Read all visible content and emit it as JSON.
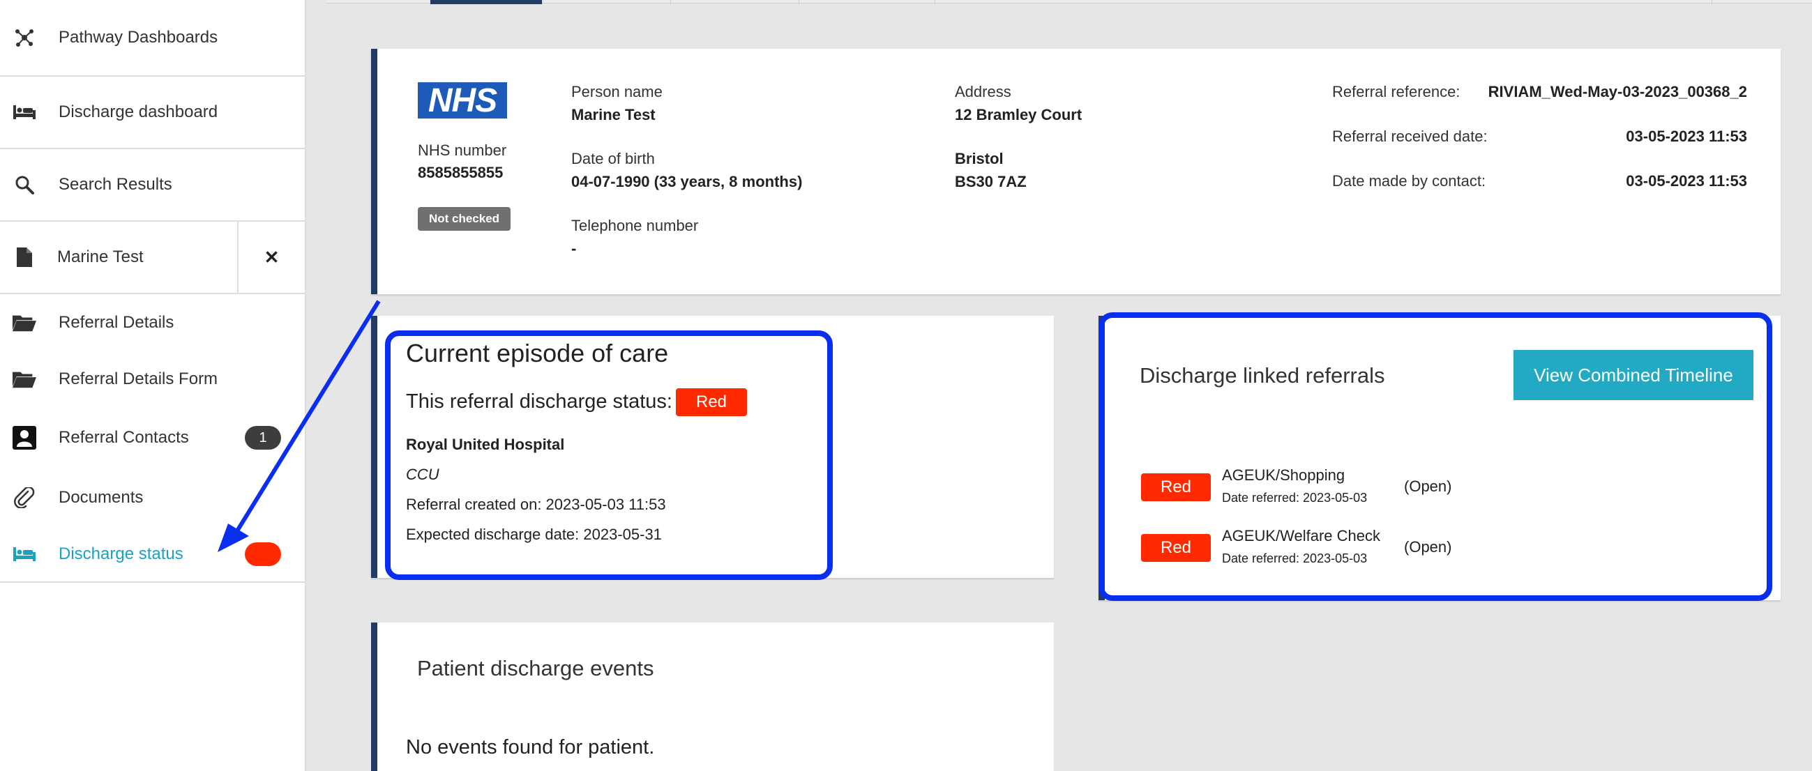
{
  "sidebar": {
    "items": [
      {
        "label": "Pathway Dashboards",
        "icon": "network-icon"
      },
      {
        "label": "Discharge dashboard",
        "icon": "bed-icon"
      },
      {
        "label": "Search Results",
        "icon": "search-icon"
      },
      {
        "label": "Marine Test",
        "icon": "file-icon",
        "close": "✕"
      },
      {
        "label": "Referral Details",
        "icon": "folder-open-icon"
      },
      {
        "label": "Referral Details Form",
        "icon": "folder-open-icon"
      },
      {
        "label": "Referral Contacts",
        "icon": "contact-icon",
        "badge": "1"
      },
      {
        "label": "Documents",
        "icon": "paperclip-icon"
      },
      {
        "label": "Discharge status",
        "icon": "bed-icon"
      }
    ]
  },
  "patient": {
    "logo_text": "NHS",
    "nhs_number_label": "NHS number",
    "nhs_number": "8585855855",
    "check_status": "Not checked",
    "person_name_label": "Person name",
    "person_name": "Marine Test",
    "dob_label": "Date of birth",
    "dob": "04-07-1990 (33 years, 8 months)",
    "telephone_label": "Telephone number",
    "telephone": "-",
    "address_label": "Address",
    "address_line1": "12 Bramley Court",
    "address_city": "Bristol",
    "address_postcode": "BS30 7AZ",
    "referral_reference_label": "Referral reference:",
    "referral_reference": "RIVIAM_Wed-May-03-2023_00368_2",
    "referral_received_label": "Referral received date:",
    "referral_received": "03-05-2023 11:53",
    "date_contact_label": "Date made by contact:",
    "date_contact": "03-05-2023 11:53"
  },
  "episode": {
    "title": "Current episode of care",
    "status_label": "This referral discharge status:",
    "status": "Red",
    "hospital": "Royal United Hospital",
    "ward": "CCU",
    "created": "Referral created on: 2023-05-03 11:53",
    "expected": "Expected discharge date: 2023-05-31"
  },
  "linked": {
    "title": "Discharge linked referrals",
    "button": "View Combined Timeline",
    "items": [
      {
        "status": "Red",
        "name": "AGEUK/Shopping",
        "date": "Date referred: 2023-05-03",
        "state": "(Open)"
      },
      {
        "status": "Red",
        "name": "AGEUK/Welfare Check",
        "date": "Date referred: 2023-05-03",
        "state": "(Open)"
      }
    ]
  },
  "events": {
    "title": "Patient discharge events",
    "empty": "No events found for patient."
  },
  "colors": {
    "accent": "#1aa2c0",
    "status_red": "#ff2a00",
    "card_border": "#233a62",
    "annotation_blue": "#0a2ef0",
    "nhs_blue": "#1e5bb8"
  }
}
